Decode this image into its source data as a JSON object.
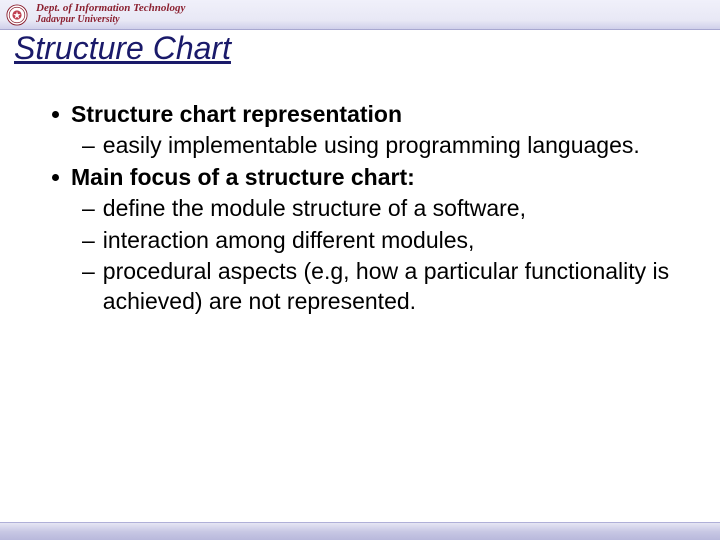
{
  "header": {
    "dept_line1": "Dept. of Information Technology",
    "dept_line2": "Jadavpur University"
  },
  "title": "Structure Chart",
  "bullets": [
    {
      "label": "Structure chart representation",
      "subs": [
        "easily implementable using programming languages."
      ]
    },
    {
      "label": "Main focus of a  structure chart:",
      "subs": [
        "define the module structure of a software,",
        "interaction among different modules,",
        "procedural aspects (e.g,  how a particular functionality is achieved) are not represented."
      ]
    }
  ]
}
